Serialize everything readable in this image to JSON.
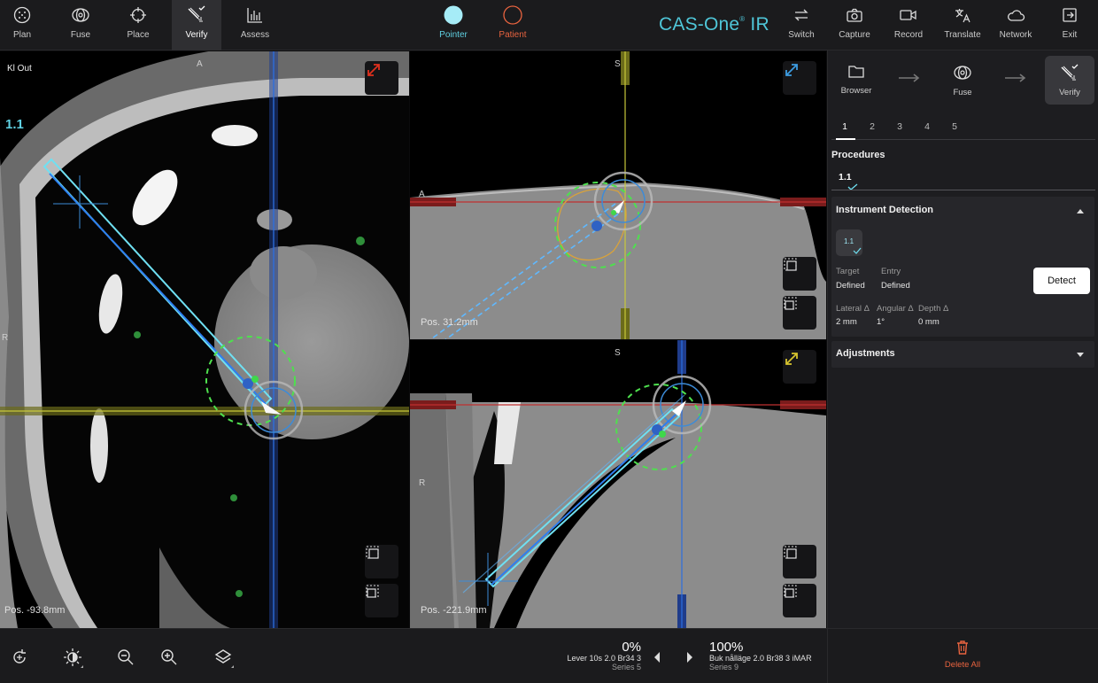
{
  "topbar": {
    "tools": [
      {
        "label": "Plan",
        "icon": "plan-icon"
      },
      {
        "label": "Fuse",
        "icon": "fuse-icon"
      },
      {
        "label": "Place",
        "icon": "place-crosshair-icon"
      },
      {
        "label": "Verify",
        "icon": "verify-needle-icon",
        "active": true
      },
      {
        "label": "Assess",
        "icon": "assess-chart-icon"
      }
    ],
    "pointer_label": "Pointer",
    "patient_label": "Patient",
    "brand": "CAS-One",
    "brand_suffix": "IR",
    "actions": [
      {
        "label": "Switch",
        "icon": "switch-icon"
      },
      {
        "label": "Capture",
        "icon": "camera-icon"
      },
      {
        "label": "Record",
        "icon": "video-icon"
      },
      {
        "label": "Translate",
        "icon": "translate-icon"
      },
      {
        "label": "Network",
        "icon": "cloud-icon"
      },
      {
        "label": "Exit",
        "icon": "exit-icon"
      }
    ],
    "colors": {
      "pointer": "#a6ecf7",
      "patient": "#e8633f",
      "brand": "#4fc6d8"
    }
  },
  "viewports": {
    "axial": {
      "tag_top": "A",
      "tag_left": "R",
      "corner_text": "Kl  Out",
      "procedure": "1.1",
      "position": "Pos. -93.8mm",
      "expand_color": "#e0301e"
    },
    "coronal": {
      "tag_top": "S",
      "tag_left": "A",
      "position": "Pos. 31.2mm",
      "expand_color": "#3c9be0"
    },
    "sagittal": {
      "tag_top": "S",
      "tag_left": "R",
      "position": "Pos. -221.9mm",
      "expand_color": "#d7c42e"
    }
  },
  "panel": {
    "workflow": [
      {
        "label": "Browser",
        "icon": "folder-icon"
      },
      {
        "label": "Fuse",
        "icon": "fuse-icon"
      },
      {
        "label": "Verify",
        "icon": "verify-needle-icon",
        "active": true
      }
    ],
    "tabs": [
      "1",
      "2",
      "3",
      "4",
      "5"
    ],
    "procedures_title": "Procedures",
    "procedure_item": "1.1",
    "instrument_detection": {
      "title": "Instrument Detection",
      "chip": "1.1",
      "target_label": "Target",
      "target_value": "Defined",
      "entry_label": "Entry",
      "entry_value": "Defined",
      "detect_label": "Detect",
      "lateral_label": "Lateral Δ",
      "lateral_value": "2 mm",
      "angular_label": "Angular Δ",
      "angular_value": "1°",
      "depth_label": "Depth Δ",
      "depth_value": "0 mm"
    },
    "adjustments_title": "Adjustments"
  },
  "bottombar": {
    "tools": [
      {
        "icon": "reset-view-icon"
      },
      {
        "icon": "brightness-icon"
      },
      {
        "icon": "zoom-out-icon"
      },
      {
        "icon": "zoom-in-icon"
      },
      {
        "icon": "layers-icon"
      }
    ],
    "series_left": {
      "percent": "0%",
      "name": "Lever 10s  2.0  Br34  3",
      "series": "Series 5"
    },
    "series_right": {
      "percent": "100%",
      "name": "Buk nålläge  2.0  Br38  3 iMAR",
      "series": "Series 9"
    },
    "delete_all_label": "Delete All",
    "delete_color": "#e8633f"
  }
}
